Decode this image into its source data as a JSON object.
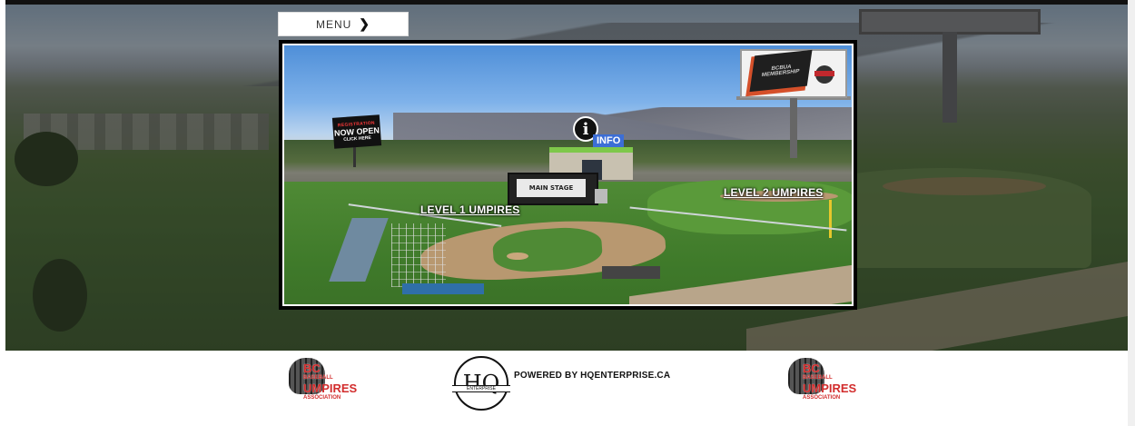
{
  "menu": {
    "label": "MENU",
    "icon": "chevron-right-icon"
  },
  "scene": {
    "registration_sign": {
      "line1": "REGISTRATION",
      "line2": "NOW OPEN",
      "line3": "CLICK HERE"
    },
    "main_stage": "MAIN STAGE",
    "info": {
      "icon_glyph": "i",
      "label": "INFO"
    },
    "level1": "LEVEL 1 UMPIRES",
    "level2": "LEVEL 2 UMPIRES",
    "billboard": {
      "book_title": "BCBUA",
      "book_subtitle": "MEMBERSHIP"
    }
  },
  "footer": {
    "left_logo": {
      "line1": "BC",
      "small1": "BASEBALL",
      "line2": "UMPIRES",
      "small2": "ASSOCIATION"
    },
    "hq_logo": {
      "letters": "HQ",
      "band": "ENTERPRISE"
    },
    "powered_by": "POWERED BY HQENTERPRISE.CA",
    "right_logo": {
      "line1": "BC",
      "small1": "BASEBALL",
      "line2": "UMPIRES",
      "small2": "ASSOCIATION"
    }
  },
  "colors": {
    "info_blue": "#3c6ed6",
    "logo_red": "#d22c2c",
    "field_green": "#4f8a35"
  }
}
